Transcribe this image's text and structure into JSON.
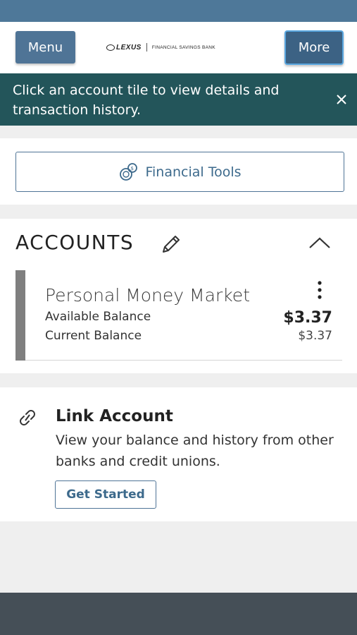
{
  "header": {
    "menu_label": "Menu",
    "more_label": "More",
    "logo_brand": "LEXUS",
    "logo_bank": "FINANCIAL SAVINGS BANK"
  },
  "banner": {
    "message": "Click an account tile to view details and transaction history.",
    "close_glyph": "×"
  },
  "tools": {
    "label": "Financial Tools"
  },
  "accounts": {
    "title": "ACCOUNTS",
    "items": [
      {
        "name": "Personal Money Market",
        "available_label": "Available Balance",
        "available_value": "$3.37",
        "current_label": "Current Balance",
        "current_value": "$3.37"
      }
    ]
  },
  "link_account": {
    "title": "Link Account",
    "description": "View your balance and history from other banks and credit unions.",
    "button_label": "Get Started"
  },
  "colors": {
    "status_bar": "#4e7899",
    "banner": "#23555a",
    "button_primary": "#4f7496",
    "footer": "#454f57"
  },
  "icons": [
    "close-icon",
    "financial-tools-icon",
    "pencil-icon",
    "chevron-up-icon",
    "kebab-menu-icon",
    "link-icon"
  ]
}
